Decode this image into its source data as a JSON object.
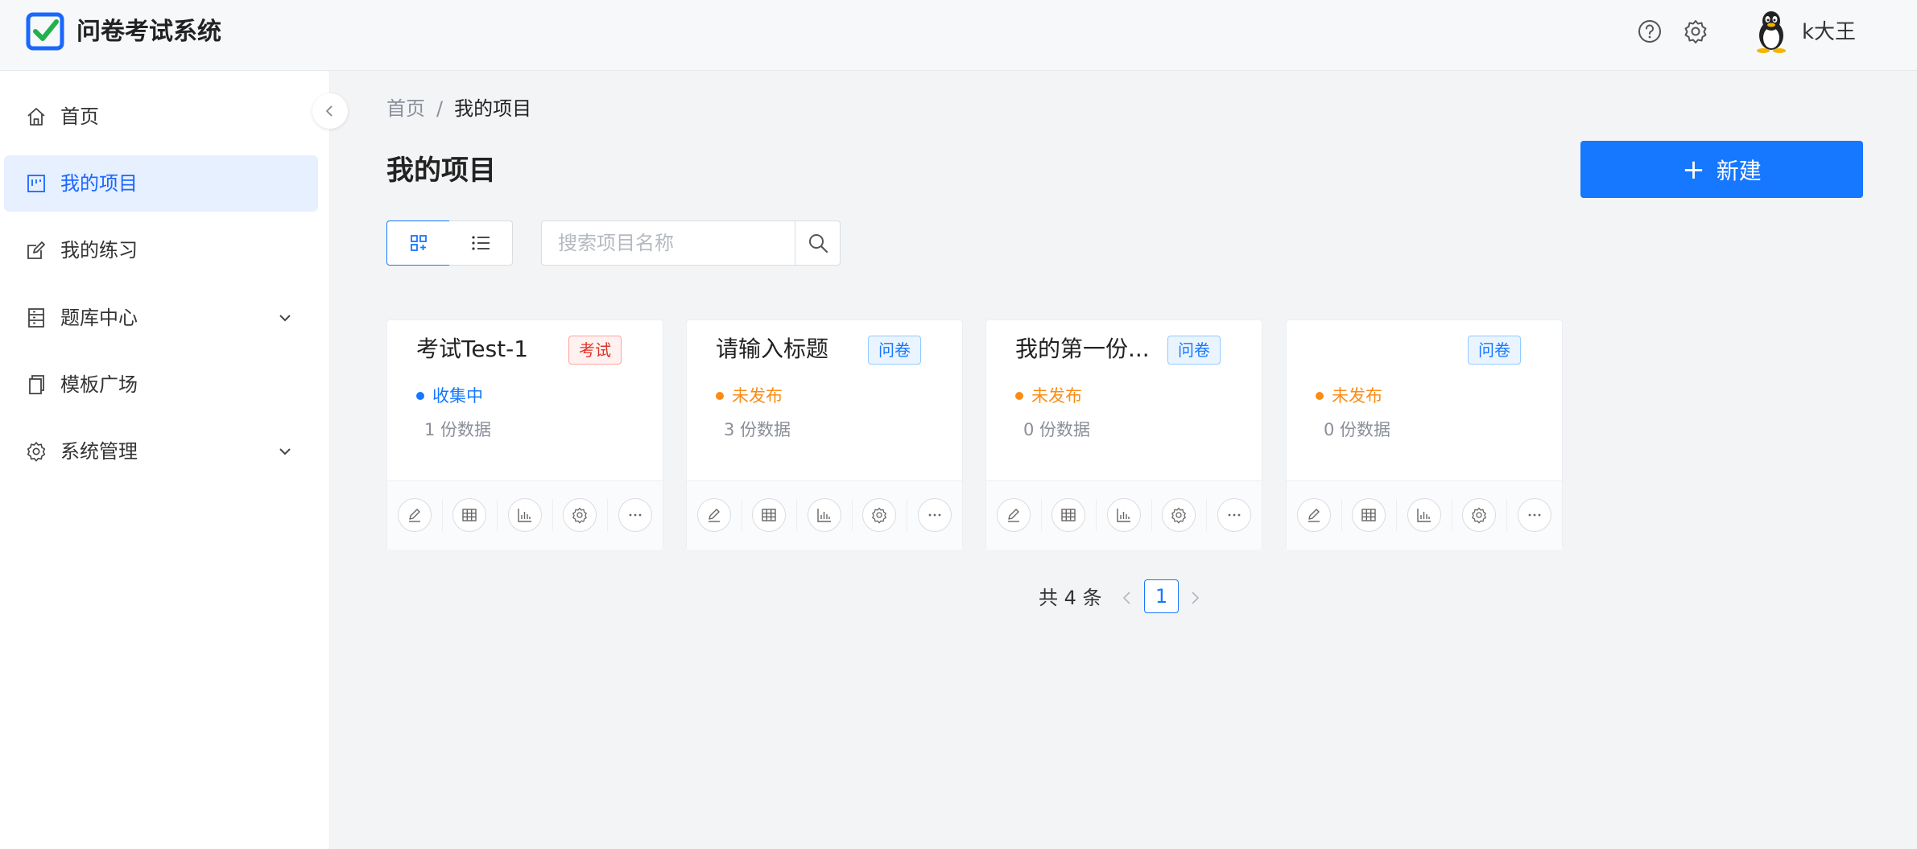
{
  "header": {
    "title": "问卷考试系统",
    "user_name": "k大王",
    "icons": [
      "help-icon",
      "settings-icon"
    ]
  },
  "sidebar": {
    "items": [
      {
        "label": "首页",
        "icon": "home-icon"
      },
      {
        "label": "我的项目",
        "icon": "project-icon",
        "active": true
      },
      {
        "label": "我的练习",
        "icon": "edit-icon"
      },
      {
        "label": "题库中心",
        "icon": "question-bank-icon",
        "expandable": true
      },
      {
        "label": "模板广场",
        "icon": "template-icon"
      },
      {
        "label": "系统管理",
        "icon": "gear-icon",
        "expandable": true
      }
    ]
  },
  "breadcrumb": {
    "home": "首页",
    "separator": "/",
    "current": "我的项目"
  },
  "page": {
    "title": "我的项目",
    "new_button": "新建",
    "new_button_icon": "+",
    "search_placeholder": "搜索项目名称"
  },
  "cards": [
    {
      "title": "考试Test-1",
      "tag": "考试",
      "status": "收集中",
      "count": "1 份数据"
    },
    {
      "title": "请输入标题",
      "tag": "问卷",
      "status": "未发布",
      "count": "3 份数据"
    },
    {
      "title": "我的第一份...",
      "tag": "问卷",
      "status": "未发布",
      "count": "0 份数据"
    },
    {
      "title": "",
      "tag": "问卷",
      "status": "未发布",
      "count": "0 份数据"
    }
  ],
  "card_actions": [
    "edit-icon",
    "table-icon",
    "chart-icon",
    "settings-icon",
    "more-icon"
  ],
  "pagination": {
    "total": "共 4 条",
    "current_page": "1"
  },
  "colors": {
    "primary": "#1677ff",
    "exam_tag": "#e0342a",
    "collecting": "#1677ff",
    "unpublished": "#fa8c16"
  }
}
